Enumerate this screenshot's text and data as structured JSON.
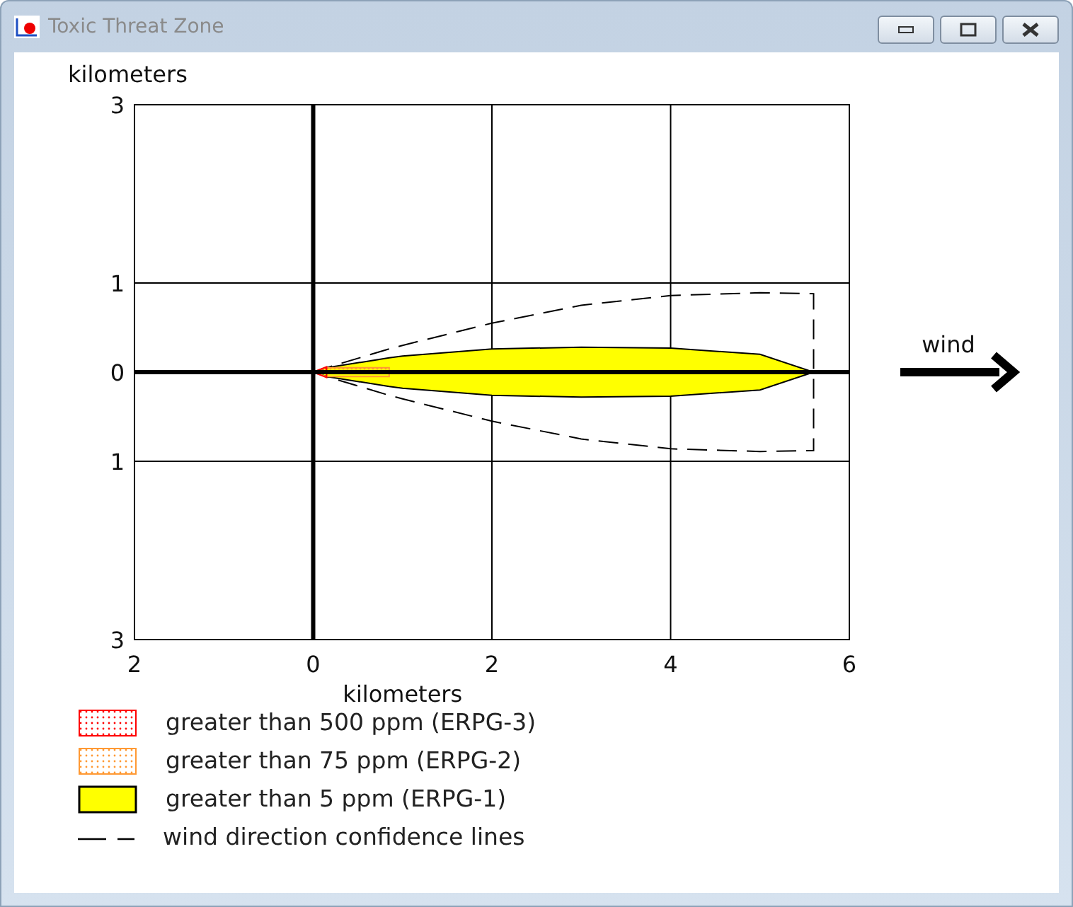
{
  "window": {
    "title": "Toxic Threat Zone"
  },
  "plot": {
    "y_axis_title": "kilometers",
    "x_axis_title": "kilometers",
    "y_ticks": [
      "3",
      "1",
      "0",
      "1",
      "3"
    ],
    "x_ticks": [
      "2",
      "0",
      "2",
      "4",
      "6"
    ],
    "wind_label": "wind"
  },
  "legend": [
    {
      "label": "greater than 500 ppm (ERPG-3)",
      "kind": "dotted",
      "color": "#ff0000"
    },
    {
      "label": "greater than 75 ppm (ERPG-2)",
      "kind": "dotted",
      "color": "#ff9933"
    },
    {
      "label": "greater than 5 ppm (ERPG-1)",
      "kind": "solid",
      "color": "#ffff00"
    },
    {
      "label": "wind direction confidence lines",
      "kind": "dashed",
      "color": "#000000"
    }
  ]
}
